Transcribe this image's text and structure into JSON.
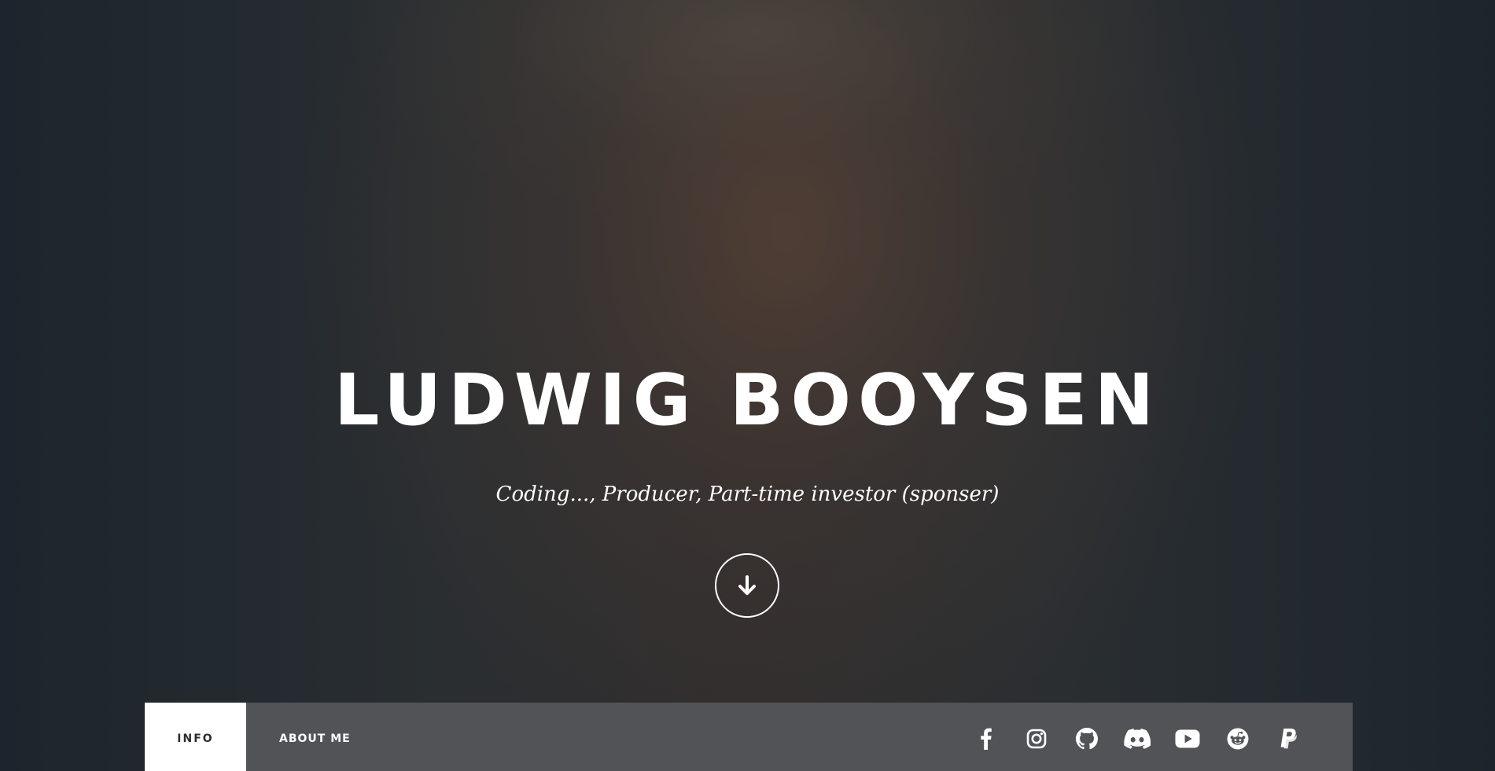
{
  "hero": {
    "title": "LUDWIG BOOYSEN",
    "subtitle": "Coding..., Producer, Part-time investor (sponser)",
    "scroll_icon": "arrow-down-icon"
  },
  "nav": {
    "tabs": [
      {
        "label": "INFO",
        "active": true
      },
      {
        "label": "ABOUT ME",
        "active": false
      }
    ],
    "social": [
      {
        "icon": "facebook-icon"
      },
      {
        "icon": "instagram-icon"
      },
      {
        "icon": "github-icon"
      },
      {
        "icon": "discord-icon"
      },
      {
        "icon": "youtube-icon"
      },
      {
        "icon": "reddit-icon"
      },
      {
        "icon": "paypal-icon"
      }
    ]
  },
  "colors": {
    "nav_background": "#525357",
    "active_tab_background": "#ffffff",
    "active_tab_text": "#2b2d33",
    "text": "#ffffff"
  }
}
